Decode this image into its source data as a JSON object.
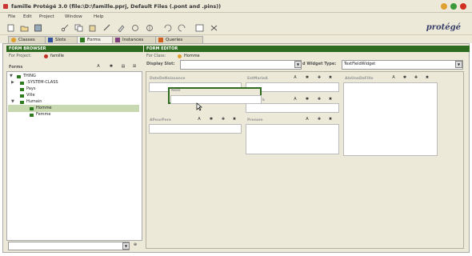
{
  "window": {
    "title": "famille  Protégé 3.0    (file:\\D:\\famille.pprj, Default Files (.pont and .pins))"
  },
  "menu": [
    "File",
    "Edit",
    "Project",
    "Window",
    "Help"
  ],
  "logo": "protégé",
  "tabs": [
    "Classes",
    "Slots",
    "Forms",
    "Instances",
    "Queries"
  ],
  "form_browser": {
    "header": "FORM BROWSER",
    "for_project_label": "For Project:",
    "project_name": "famille",
    "forms_label": "Forms",
    "tree": [
      {
        "label": "THING",
        "level": 0
      },
      {
        "label": ":SYSTEM-CLASS",
        "level": 1
      },
      {
        "label": "Pays",
        "level": 1
      },
      {
        "label": "Ville",
        "level": 1
      },
      {
        "label": "Humain",
        "level": 1
      },
      {
        "label": "Homme",
        "level": 2,
        "selected": true
      },
      {
        "label": "Femme",
        "level": 2
      }
    ]
  },
  "form_editor": {
    "header": "FORM EDITOR",
    "for_class_label": "For Class:",
    "class_name": "Homme",
    "display_slot_label": "Display Slot:",
    "widget_type_label": "d Widget Type:",
    "widget_type_value": "TextFieldWidget",
    "fields": {
      "date_naissance": "DateDeNaissance",
      "est_marie": "EstMarieA",
      "nom": "Nom",
      "k": "k",
      "a_pour_pere": "APourPere",
      "prenom": "Prenom",
      "a_la_fille": "AlaUneDeFille",
      "lis": "Lis"
    }
  },
  "colors": {
    "panel_header": "#2f6b1e",
    "selected_row": "#c8d8b0",
    "background": "#ece9d8"
  }
}
